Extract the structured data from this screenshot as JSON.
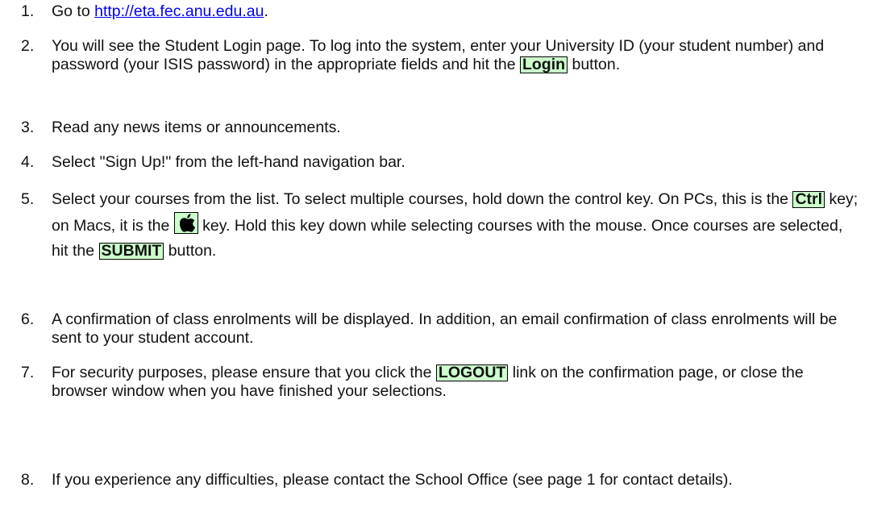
{
  "steps": [
    {
      "num": "1.",
      "pre": "Go to ",
      "link": "http://eta.fec.anu.edu.au",
      "post": "."
    },
    {
      "num": "2.",
      "pre": "You will see the Student Login page. To log into the system, enter your University ID (your student number) and password (your ISIS password) in the appropriate fields and hit the ",
      "key": "Login",
      "post": " button."
    },
    {
      "num": "3.",
      "text": "Read any news items or announcements."
    },
    {
      "num": "4.",
      "text": "Select \"Sign Up!\" from the left-hand navigation bar."
    },
    {
      "num": "5.",
      "a": "Select your courses from the list. To select multiple courses, hold down the control key. On PCs, this is the ",
      "key1": "Ctrl",
      "b": " key; on Macs, it is the ",
      "icon": "apple-command-key-icon",
      "c": " key. Hold this key down while selecting courses with the mouse. Once courses are selected, hit the ",
      "key2": "SUBMIT",
      "d": " button."
    },
    {
      "num": "6.",
      "text": "A confirmation of class enrolments will be displayed. In addition, an email confirmation of class enrolments will be sent to your student account."
    },
    {
      "num": "7.",
      "pre": "For security purposes, please ensure that you click the ",
      "key": "LOGOUT",
      "post": " link on the confirmation page, or close the browser window when you have finished your selections."
    },
    {
      "num": "8.",
      "text": "If you experience any difficulties, please contact the School Office (see page 1 for contact details)."
    }
  ],
  "colors": {
    "key_highlight": "#ccffcc",
    "link": "#0000ee",
    "text": "#111111"
  }
}
